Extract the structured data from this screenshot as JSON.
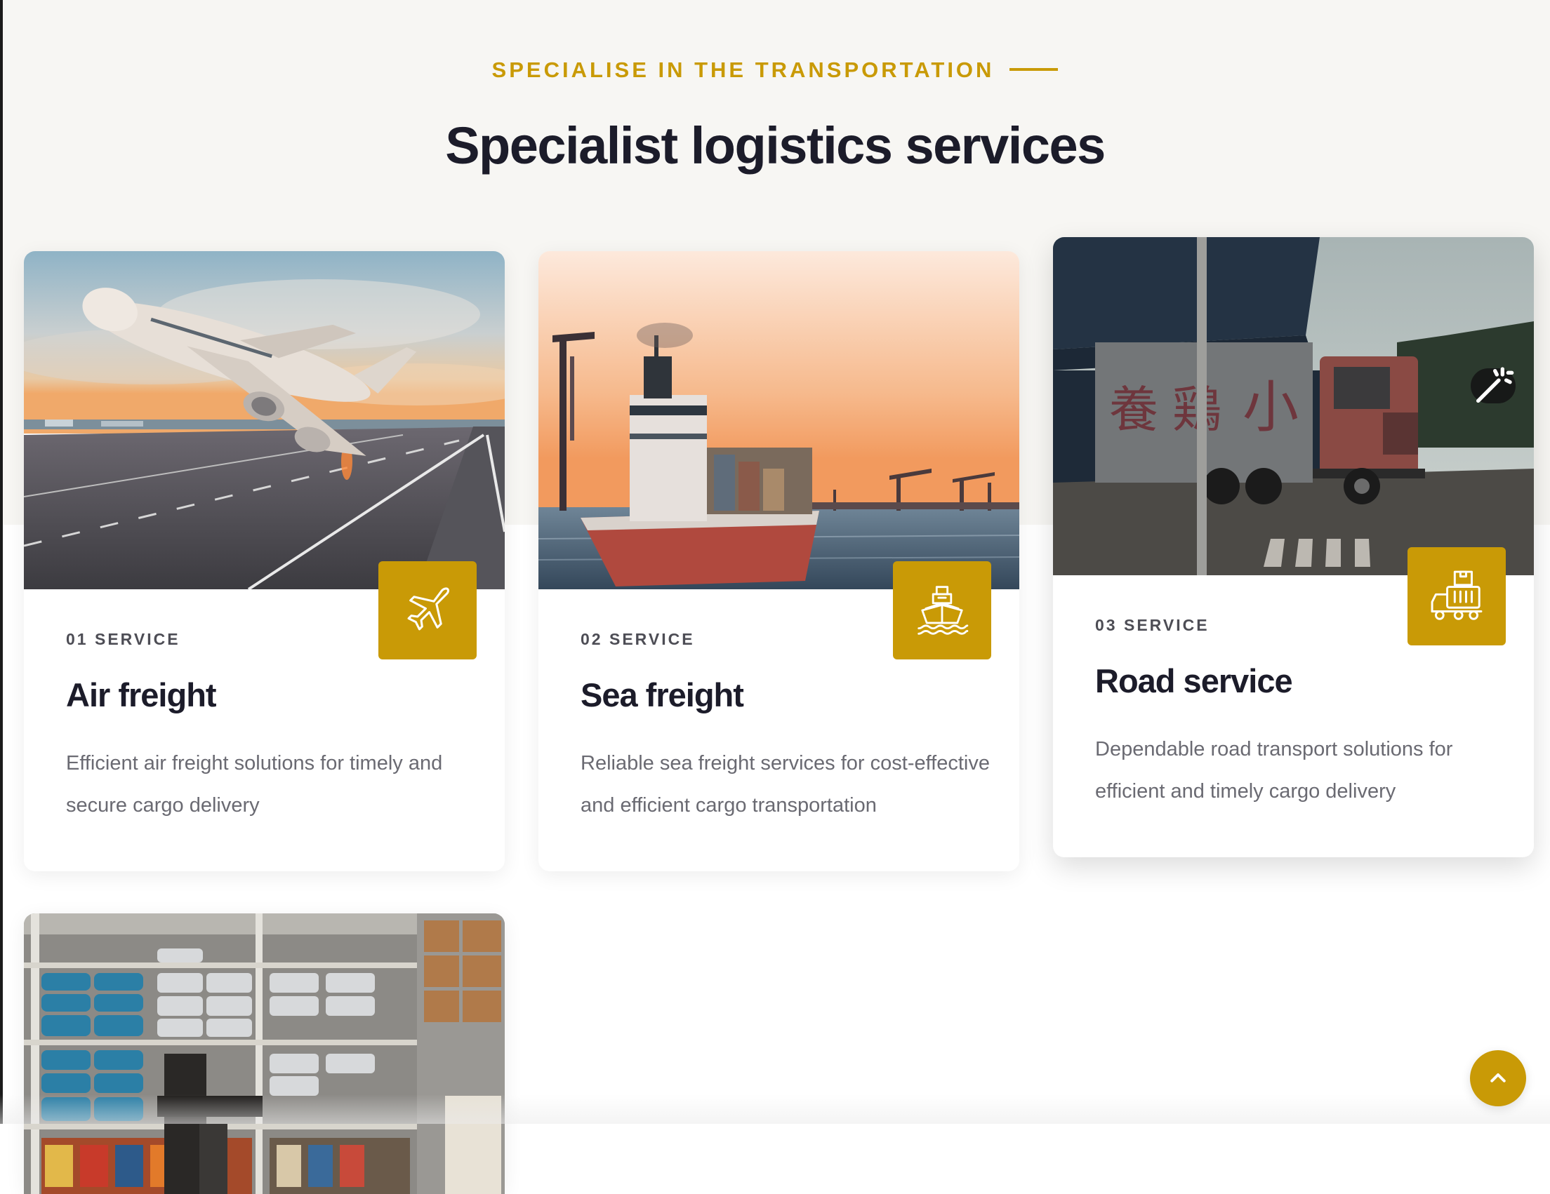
{
  "section": {
    "eyebrow": "SPECIALISE IN THE TRANSPORTATION",
    "heading": "Specialist logistics services"
  },
  "colors": {
    "accent": "#c99a06",
    "heading": "#1c1c2a",
    "body_text": "#6a6a72",
    "band_background": "#f7f6f3"
  },
  "services": [
    {
      "number_label": "01 SERVICE",
      "title": "Air freight",
      "description": "Efficient air freight solutions for timely and secure cargo delivery",
      "icon": "airplane-icon",
      "image": "airplane-takeoff-photo"
    },
    {
      "number_label": "02 SERVICE",
      "title": "Sea freight",
      "description": "Reliable sea freight services for cost-effective and efficient cargo transportation",
      "icon": "ship-icon",
      "image": "cargo-ship-photo"
    },
    {
      "number_label": "03 SERVICE",
      "title": "Road service",
      "description": "Dependable road transport solutions for efficient and timely cargo delivery",
      "icon": "delivery-truck-icon",
      "image": "truck-photo",
      "image_overlay_icon": "magic-wand-icon"
    },
    {
      "image": "warehouse-photo"
    }
  ],
  "scroll_top": {
    "icon": "chevron-up-icon"
  }
}
